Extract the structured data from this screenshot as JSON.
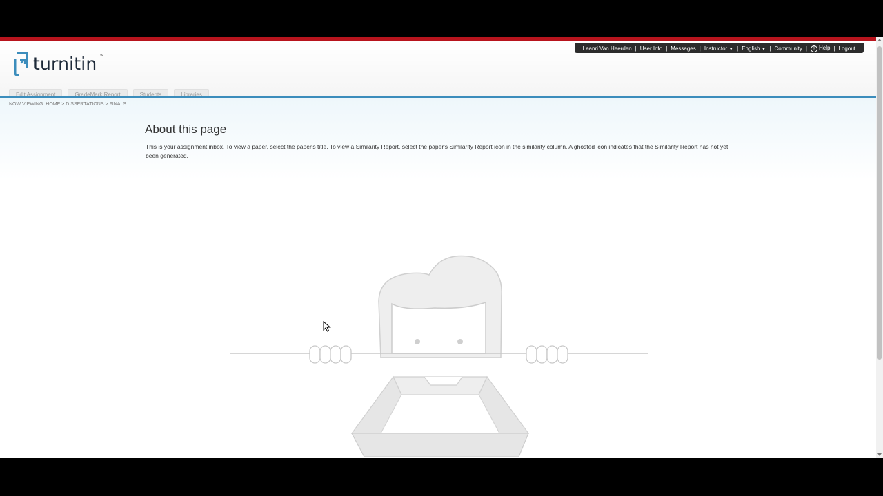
{
  "brand": {
    "name": "turnitin",
    "tm": "™",
    "icon": "turnitin-logo-icon",
    "accent_color": "#3c8dbc",
    "stripe_color": "#b8141d"
  },
  "top_nav": {
    "user": "Leanri Van Heerden",
    "user_info": "User Info",
    "messages": "Messages",
    "role": "Instructor",
    "language": "English",
    "community": "Community",
    "help": "Help",
    "logout": "Logout"
  },
  "tabs": [
    {
      "label": "Edit Assignment"
    },
    {
      "label": "GradeMark Report"
    },
    {
      "label": "Students"
    },
    {
      "label": "Libraries"
    }
  ],
  "breadcrumb": {
    "prefix": "NOW VIEWING:",
    "items": [
      "HOME",
      "DISSERTATIONS",
      "FINALS"
    ],
    "separator": ">"
  },
  "main": {
    "title": "About this page",
    "description": "This is your assignment inbox. To view a paper, select the paper's title. To view a Similarity Report, select the paper's Similarity Report icon in the similarity column. A ghosted icon indicates that the Similarity Report has not yet been generated."
  },
  "illustration": {
    "name": "empty-inbox-illustration"
  }
}
